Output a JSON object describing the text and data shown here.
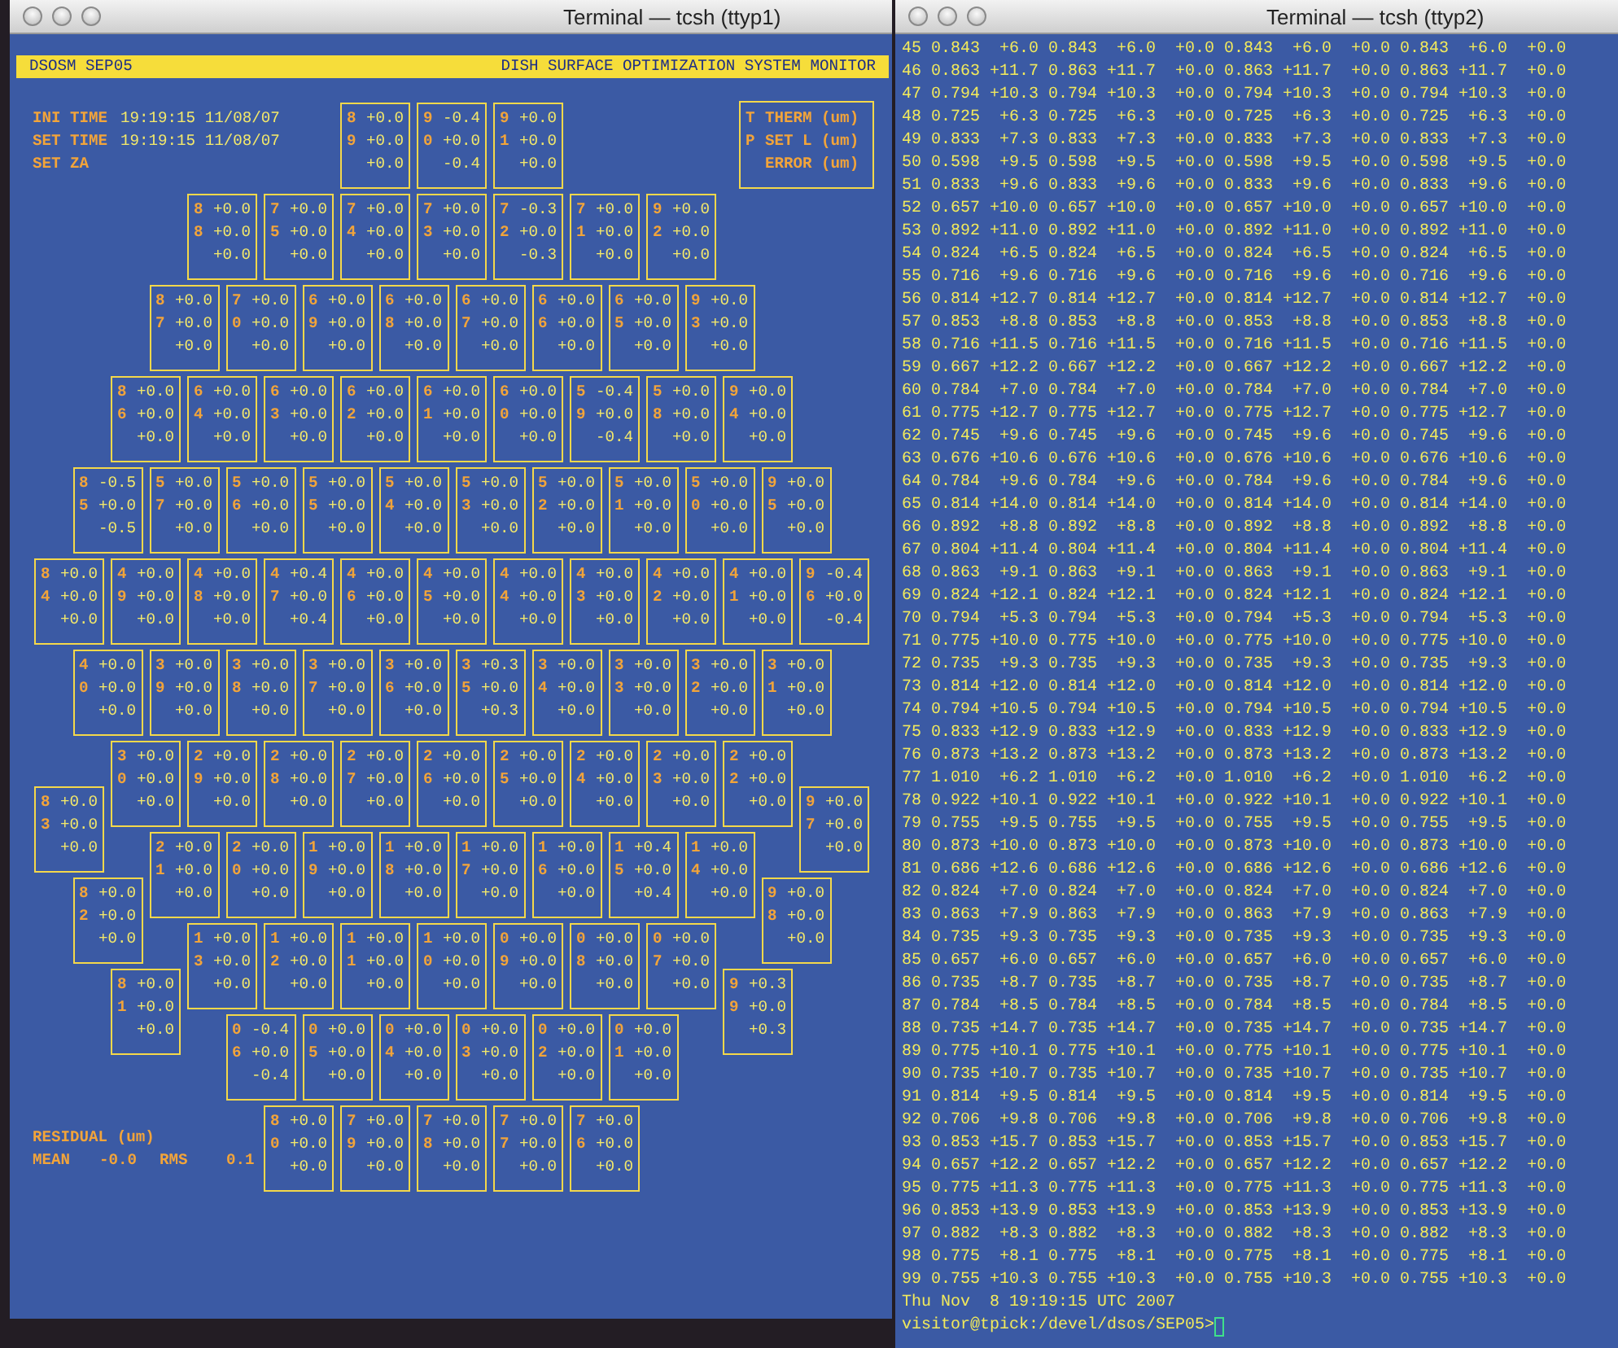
{
  "left_window": {
    "title": "Terminal — tcsh (ttyp1)",
    "header": {
      "left": "DSOSM SEP05",
      "right": "DISH SURFACE OPTIMIZATION SYSTEM MONITOR"
    },
    "times": [
      {
        "label": "INI TIME",
        "value": "19:19:15 11/08/07"
      },
      {
        "label": "SET TIME",
        "value": "19:19:15 11/08/07"
      },
      {
        "label": "SET ZA"
      }
    ],
    "legend": [
      {
        "key": "T",
        "label": "THERM (um)"
      },
      {
        "key": "P",
        "label": "SET L (um)"
      },
      {
        "label": "ERROR (um)"
      }
    ],
    "panel_rows": [
      [
        {
          "t": "8",
          "therm": "+0.0",
          "p": "9",
          "set_l": "+0.0",
          "error": "+0.0"
        },
        {
          "t": "9",
          "therm": "-0.4",
          "p": "0",
          "set_l": "+0.0",
          "error": "-0.4"
        },
        {
          "t": "9",
          "therm": "+0.0",
          "p": "1",
          "set_l": "+0.0",
          "error": "+0.0"
        }
      ],
      [
        {
          "t": "8",
          "therm": "+0.0",
          "p": "8",
          "set_l": "+0.0",
          "error": "+0.0"
        },
        {
          "t": "7",
          "therm": "+0.0",
          "p": "5",
          "set_l": "+0.0",
          "error": "+0.0"
        },
        {
          "t": "7",
          "therm": "+0.0",
          "p": "4",
          "set_l": "+0.0",
          "error": "+0.0"
        },
        {
          "t": "7",
          "therm": "+0.0",
          "p": "3",
          "set_l": "+0.0",
          "error": "+0.0"
        },
        {
          "t": "7",
          "therm": "-0.3",
          "p": "2",
          "set_l": "+0.0",
          "error": "-0.3"
        },
        {
          "t": "7",
          "therm": "+0.0",
          "p": "1",
          "set_l": "+0.0",
          "error": "+0.0"
        },
        {
          "t": "9",
          "therm": "+0.0",
          "p": "2",
          "set_l": "+0.0",
          "error": "+0.0"
        }
      ],
      [
        {
          "t": "8",
          "therm": "+0.0",
          "p": "7",
          "set_l": "+0.0",
          "error": "+0.0"
        },
        {
          "t": "7",
          "therm": "+0.0",
          "p": "0",
          "set_l": "+0.0",
          "error": "+0.0"
        },
        {
          "t": "6",
          "therm": "+0.0",
          "p": "9",
          "set_l": "+0.0",
          "error": "+0.0"
        },
        {
          "t": "6",
          "therm": "+0.0",
          "p": "8",
          "set_l": "+0.0",
          "error": "+0.0"
        },
        {
          "t": "6",
          "therm": "+0.0",
          "p": "7",
          "set_l": "+0.0",
          "error": "+0.0"
        },
        {
          "t": "6",
          "therm": "+0.0",
          "p": "6",
          "set_l": "+0.0",
          "error": "+0.0"
        },
        {
          "t": "6",
          "therm": "+0.0",
          "p": "5",
          "set_l": "+0.0",
          "error": "+0.0"
        },
        {
          "t": "9",
          "therm": "+0.0",
          "p": "3",
          "set_l": "+0.0",
          "error": "+0.0"
        }
      ],
      [
        {
          "t": "8",
          "therm": "+0.0",
          "p": "6",
          "set_l": "+0.0",
          "error": "+0.0"
        },
        {
          "t": "6",
          "therm": "+0.0",
          "p": "4",
          "set_l": "+0.0",
          "error": "+0.0"
        },
        {
          "t": "6",
          "therm": "+0.0",
          "p": "3",
          "set_l": "+0.0",
          "error": "+0.0"
        },
        {
          "t": "6",
          "therm": "+0.0",
          "p": "2",
          "set_l": "+0.0",
          "error": "+0.0"
        },
        {
          "t": "6",
          "therm": "+0.0",
          "p": "1",
          "set_l": "+0.0",
          "error": "+0.0"
        },
        {
          "t": "6",
          "therm": "+0.0",
          "p": "0",
          "set_l": "+0.0",
          "error": "+0.0"
        },
        {
          "t": "5",
          "therm": "-0.4",
          "p": "9",
          "set_l": "+0.0",
          "error": "-0.4"
        },
        {
          "t": "5",
          "therm": "+0.0",
          "p": "8",
          "set_l": "+0.0",
          "error": "+0.0"
        },
        {
          "t": "9",
          "therm": "+0.0",
          "p": "4",
          "set_l": "+0.0",
          "error": "+0.0"
        }
      ],
      [
        {
          "t": "8",
          "therm": "-0.5",
          "p": "5",
          "set_l": "+0.0",
          "error": "-0.5"
        },
        {
          "t": "5",
          "therm": "+0.0",
          "p": "7",
          "set_l": "+0.0",
          "error": "+0.0"
        },
        {
          "t": "5",
          "therm": "+0.0",
          "p": "6",
          "set_l": "+0.0",
          "error": "+0.0"
        },
        {
          "t": "5",
          "therm": "+0.0",
          "p": "5",
          "set_l": "+0.0",
          "error": "+0.0"
        },
        {
          "t": "5",
          "therm": "+0.0",
          "p": "4",
          "set_l": "+0.0",
          "error": "+0.0"
        },
        {
          "t": "5",
          "therm": "+0.0",
          "p": "3",
          "set_l": "+0.0",
          "error": "+0.0"
        },
        {
          "t": "5",
          "therm": "+0.0",
          "p": "2",
          "set_l": "+0.0",
          "error": "+0.0"
        },
        {
          "t": "5",
          "therm": "+0.0",
          "p": "1",
          "set_l": "+0.0",
          "error": "+0.0"
        },
        {
          "t": "5",
          "therm": "+0.0",
          "p": "0",
          "set_l": "+0.0",
          "error": "+0.0"
        },
        {
          "t": "9",
          "therm": "+0.0",
          "p": "5",
          "set_l": "+0.0",
          "error": "+0.0"
        }
      ],
      [
        {
          "t": "8",
          "therm": "+0.0",
          "p": "4",
          "set_l": "+0.0",
          "error": "+0.0"
        },
        {
          "t": "4",
          "therm": "+0.0",
          "p": "9",
          "set_l": "+0.0",
          "error": "+0.0"
        },
        {
          "t": "4",
          "therm": "+0.0",
          "p": "8",
          "set_l": "+0.0",
          "error": "+0.0"
        },
        {
          "t": "4",
          "therm": "+0.4",
          "p": "7",
          "set_l": "+0.0",
          "error": "+0.4"
        },
        {
          "t": "4",
          "therm": "+0.0",
          "p": "6",
          "set_l": "+0.0",
          "error": "+0.0"
        },
        {
          "t": "4",
          "therm": "+0.0",
          "p": "5",
          "set_l": "+0.0",
          "error": "+0.0"
        },
        {
          "t": "4",
          "therm": "+0.0",
          "p": "4",
          "set_l": "+0.0",
          "error": "+0.0"
        },
        {
          "t": "4",
          "therm": "+0.0",
          "p": "3",
          "set_l": "+0.0",
          "error": "+0.0"
        },
        {
          "t": "4",
          "therm": "+0.0",
          "p": "2",
          "set_l": "+0.0",
          "error": "+0.0"
        },
        {
          "t": "4",
          "therm": "+0.0",
          "p": "1",
          "set_l": "+0.0",
          "error": "+0.0"
        },
        {
          "t": "9",
          "therm": "-0.4",
          "p": "6",
          "set_l": "+0.0",
          "error": "-0.4"
        }
      ],
      [
        {
          "t": "4",
          "therm": "+0.0",
          "p": "0",
          "set_l": "+0.0",
          "error": "+0.0"
        },
        {
          "t": "3",
          "therm": "+0.0",
          "p": "9",
          "set_l": "+0.0",
          "error": "+0.0"
        },
        {
          "t": "3",
          "therm": "+0.0",
          "p": "8",
          "set_l": "+0.0",
          "error": "+0.0"
        },
        {
          "t": "3",
          "therm": "+0.0",
          "p": "7",
          "set_l": "+0.0",
          "error": "+0.0"
        },
        {
          "t": "3",
          "therm": "+0.0",
          "p": "6",
          "set_l": "+0.0",
          "error": "+0.0"
        },
        {
          "t": "3",
          "therm": "+0.3",
          "p": "5",
          "set_l": "+0.0",
          "error": "+0.3"
        },
        {
          "t": "3",
          "therm": "+0.0",
          "p": "4",
          "set_l": "+0.0",
          "error": "+0.0"
        },
        {
          "t": "3",
          "therm": "+0.0",
          "p": "3",
          "set_l": "+0.0",
          "error": "+0.0"
        },
        {
          "t": "3",
          "therm": "+0.0",
          "p": "2",
          "set_l": "+0.0",
          "error": "+0.0"
        },
        {
          "t": "3",
          "therm": "+0.0",
          "p": "1",
          "set_l": "+0.0",
          "error": "+0.0"
        }
      ],
      [
        {
          "t": "3",
          "therm": "+0.0",
          "p": "0",
          "set_l": "+0.0",
          "error": "+0.0"
        },
        {
          "t": "2",
          "therm": "+0.0",
          "p": "9",
          "set_l": "+0.0",
          "error": "+0.0"
        },
        {
          "t": "2",
          "therm": "+0.0",
          "p": "8",
          "set_l": "+0.0",
          "error": "+0.0"
        },
        {
          "t": "2",
          "therm": "+0.0",
          "p": "7",
          "set_l": "+0.0",
          "error": "+0.0"
        },
        {
          "t": "2",
          "therm": "+0.0",
          "p": "6",
          "set_l": "+0.0",
          "error": "+0.0"
        },
        {
          "t": "2",
          "therm": "+0.0",
          "p": "5",
          "set_l": "+0.0",
          "error": "+0.0"
        },
        {
          "t": "2",
          "therm": "+0.0",
          "p": "4",
          "set_l": "+0.0",
          "error": "+0.0"
        },
        {
          "t": "2",
          "therm": "+0.0",
          "p": "3",
          "set_l": "+0.0",
          "error": "+0.0"
        },
        {
          "t": "2",
          "therm": "+0.0",
          "p": "2",
          "set_l": "+0.0",
          "error": "+0.0"
        }
      ],
      [
        {
          "t": "2",
          "therm": "+0.0",
          "p": "1",
          "set_l": "+0.0",
          "error": "+0.0"
        },
        {
          "t": "2",
          "therm": "+0.0",
          "p": "0",
          "set_l": "+0.0",
          "error": "+0.0"
        },
        {
          "t": "1",
          "therm": "+0.0",
          "p": "9",
          "set_l": "+0.0",
          "error": "+0.0"
        },
        {
          "t": "1",
          "therm": "+0.0",
          "p": "8",
          "set_l": "+0.0",
          "error": "+0.0"
        },
        {
          "t": "1",
          "therm": "+0.0",
          "p": "7",
          "set_l": "+0.0",
          "error": "+0.0"
        },
        {
          "t": "1",
          "therm": "+0.0",
          "p": "6",
          "set_l": "+0.0",
          "error": "+0.0"
        },
        {
          "t": "1",
          "therm": "+0.4",
          "p": "5",
          "set_l": "+0.0",
          "error": "+0.4"
        },
        {
          "t": "1",
          "therm": "+0.0",
          "p": "4",
          "set_l": "+0.0",
          "error": "+0.0"
        }
      ],
      [
        {
          "t": "1",
          "therm": "+0.0",
          "p": "3",
          "set_l": "+0.0",
          "error": "+0.0"
        },
        {
          "t": "1",
          "therm": "+0.0",
          "p": "2",
          "set_l": "+0.0",
          "error": "+0.0"
        },
        {
          "t": "1",
          "therm": "+0.0",
          "p": "1",
          "set_l": "+0.0",
          "error": "+0.0"
        },
        {
          "t": "1",
          "therm": "+0.0",
          "p": "0",
          "set_l": "+0.0",
          "error": "+0.0"
        },
        {
          "t": "0",
          "therm": "+0.0",
          "p": "9",
          "set_l": "+0.0",
          "error": "+0.0"
        },
        {
          "t": "0",
          "therm": "+0.0",
          "p": "8",
          "set_l": "+0.0",
          "error": "+0.0"
        },
        {
          "t": "0",
          "therm": "+0.0",
          "p": "7",
          "set_l": "+0.0",
          "error": "+0.0"
        }
      ],
      [
        {
          "t": "0",
          "therm": "-0.4",
          "p": "6",
          "set_l": "+0.0",
          "error": "-0.4"
        },
        {
          "t": "0",
          "therm": "+0.0",
          "p": "5",
          "set_l": "+0.0",
          "error": "+0.0"
        },
        {
          "t": "0",
          "therm": "+0.0",
          "p": "4",
          "set_l": "+0.0",
          "error": "+0.0"
        },
        {
          "t": "0",
          "therm": "+0.0",
          "p": "3",
          "set_l": "+0.0",
          "error": "+0.0"
        },
        {
          "t": "0",
          "therm": "+0.0",
          "p": "2",
          "set_l": "+0.0",
          "error": "+0.0"
        },
        {
          "t": "0",
          "therm": "+0.0",
          "p": "1",
          "set_l": "+0.0",
          "error": "+0.0"
        }
      ],
      [
        {
          "t": "8",
          "therm": "+0.0",
          "p": "0",
          "set_l": "+0.0",
          "error": "+0.0"
        },
        {
          "t": "7",
          "therm": "+0.0",
          "p": "9",
          "set_l": "+0.0",
          "error": "+0.0"
        },
        {
          "t": "7",
          "therm": "+0.0",
          "p": "8",
          "set_l": "+0.0",
          "error": "+0.0"
        },
        {
          "t": "7",
          "therm": "+0.0",
          "p": "7",
          "set_l": "+0.0",
          "error": "+0.0"
        },
        {
          "t": "7",
          "therm": "+0.0",
          "p": "6",
          "set_l": "+0.0",
          "error": "+0.0"
        }
      ]
    ],
    "side_panels": [
      {
        "t": "8",
        "therm": "+0.0",
        "p": "3",
        "set_l": "+0.0",
        "error": "+0.0"
      },
      {
        "t": "9",
        "therm": "+0.0",
        "p": "7",
        "set_l": "+0.0",
        "error": "+0.0"
      },
      {
        "t": "8",
        "therm": "+0.0",
        "p": "2",
        "set_l": "+0.0",
        "error": "+0.0"
      },
      {
        "t": "9",
        "therm": "+0.0",
        "p": "8",
        "set_l": "+0.0",
        "error": "+0.0"
      },
      {
        "t": "8",
        "therm": "+0.0",
        "p": "1",
        "set_l": "+0.0",
        "error": "+0.0"
      },
      {
        "t": "9",
        "therm": "+0.3",
        "p": "9",
        "set_l": "+0.0",
        "error": "+0.3"
      }
    ],
    "residual": {
      "title": "RESIDUAL (um)",
      "mean_label": "MEAN",
      "mean": "-0.0",
      "rms_label": "RMS",
      "rms": "0.1"
    }
  },
  "right_window": {
    "title": "Terminal — tcsh (ttyp2)",
    "lines": [
      "45 0.843  +6.0 0.843  +6.0  +0.0 0.843  +6.0  +0.0 0.843  +6.0  +0.0",
      "46 0.863 +11.7 0.863 +11.7  +0.0 0.863 +11.7  +0.0 0.863 +11.7  +0.0",
      "47 0.794 +10.3 0.794 +10.3  +0.0 0.794 +10.3  +0.0 0.794 +10.3  +0.0",
      "48 0.725  +6.3 0.725  +6.3  +0.0 0.725  +6.3  +0.0 0.725  +6.3  +0.0",
      "49 0.833  +7.3 0.833  +7.3  +0.0 0.833  +7.3  +0.0 0.833  +7.3  +0.0",
      "50 0.598  +9.5 0.598  +9.5  +0.0 0.598  +9.5  +0.0 0.598  +9.5  +0.0",
      "51 0.833  +9.6 0.833  +9.6  +0.0 0.833  +9.6  +0.0 0.833  +9.6  +0.0",
      "52 0.657 +10.0 0.657 +10.0  +0.0 0.657 +10.0  +0.0 0.657 +10.0  +0.0",
      "53 0.892 +11.0 0.892 +11.0  +0.0 0.892 +11.0  +0.0 0.892 +11.0  +0.0",
      "54 0.824  +6.5 0.824  +6.5  +0.0 0.824  +6.5  +0.0 0.824  +6.5  +0.0",
      "55 0.716  +9.6 0.716  +9.6  +0.0 0.716  +9.6  +0.0 0.716  +9.6  +0.0",
      "56 0.814 +12.7 0.814 +12.7  +0.0 0.814 +12.7  +0.0 0.814 +12.7  +0.0",
      "57 0.853  +8.8 0.853  +8.8  +0.0 0.853  +8.8  +0.0 0.853  +8.8  +0.0",
      "58 0.716 +11.5 0.716 +11.5  +0.0 0.716 +11.5  +0.0 0.716 +11.5  +0.0",
      "59 0.667 +12.2 0.667 +12.2  +0.0 0.667 +12.2  +0.0 0.667 +12.2  +0.0",
      "60 0.784  +7.0 0.784  +7.0  +0.0 0.784  +7.0  +0.0 0.784  +7.0  +0.0",
      "61 0.775 +12.7 0.775 +12.7  +0.0 0.775 +12.7  +0.0 0.775 +12.7  +0.0",
      "62 0.745  +9.6 0.745  +9.6  +0.0 0.745  +9.6  +0.0 0.745  +9.6  +0.0",
      "63 0.676 +10.6 0.676 +10.6  +0.0 0.676 +10.6  +0.0 0.676 +10.6  +0.0",
      "64 0.784  +9.6 0.784  +9.6  +0.0 0.784  +9.6  +0.0 0.784  +9.6  +0.0",
      "65 0.814 +14.0 0.814 +14.0  +0.0 0.814 +14.0  +0.0 0.814 +14.0  +0.0",
      "66 0.892  +8.8 0.892  +8.8  +0.0 0.892  +8.8  +0.0 0.892  +8.8  +0.0",
      "67 0.804 +11.4 0.804 +11.4  +0.0 0.804 +11.4  +0.0 0.804 +11.4  +0.0",
      "68 0.863  +9.1 0.863  +9.1  +0.0 0.863  +9.1  +0.0 0.863  +9.1  +0.0",
      "69 0.824 +12.1 0.824 +12.1  +0.0 0.824 +12.1  +0.0 0.824 +12.1  +0.0",
      "70 0.794  +5.3 0.794  +5.3  +0.0 0.794  +5.3  +0.0 0.794  +5.3  +0.0",
      "71 0.775 +10.0 0.775 +10.0  +0.0 0.775 +10.0  +0.0 0.775 +10.0  +0.0",
      "72 0.735  +9.3 0.735  +9.3  +0.0 0.735  +9.3  +0.0 0.735  +9.3  +0.0",
      "73 0.814 +12.0 0.814 +12.0  +0.0 0.814 +12.0  +0.0 0.814 +12.0  +0.0",
      "74 0.794 +10.5 0.794 +10.5  +0.0 0.794 +10.5  +0.0 0.794 +10.5  +0.0",
      "75 0.833 +12.9 0.833 +12.9  +0.0 0.833 +12.9  +0.0 0.833 +12.9  +0.0",
      "76 0.873 +13.2 0.873 +13.2  +0.0 0.873 +13.2  +0.0 0.873 +13.2  +0.0",
      "77 1.010  +6.2 1.010  +6.2  +0.0 1.010  +6.2  +0.0 1.010  +6.2  +0.0",
      "78 0.922 +10.1 0.922 +10.1  +0.0 0.922 +10.1  +0.0 0.922 +10.1  +0.0",
      "79 0.755  +9.5 0.755  +9.5  +0.0 0.755  +9.5  +0.0 0.755  +9.5  +0.0",
      "80 0.873 +10.0 0.873 +10.0  +0.0 0.873 +10.0  +0.0 0.873 +10.0  +0.0",
      "81 0.686 +12.6 0.686 +12.6  +0.0 0.686 +12.6  +0.0 0.686 +12.6  +0.0",
      "82 0.824  +7.0 0.824  +7.0  +0.0 0.824  +7.0  +0.0 0.824  +7.0  +0.0",
      "83 0.863  +7.9 0.863  +7.9  +0.0 0.863  +7.9  +0.0 0.863  +7.9  +0.0",
      "84 0.735  +9.3 0.735  +9.3  +0.0 0.735  +9.3  +0.0 0.735  +9.3  +0.0",
      "85 0.657  +6.0 0.657  +6.0  +0.0 0.657  +6.0  +0.0 0.657  +6.0  +0.0",
      "86 0.735  +8.7 0.735  +8.7  +0.0 0.735  +8.7  +0.0 0.735  +8.7  +0.0",
      "87 0.784  +8.5 0.784  +8.5  +0.0 0.784  +8.5  +0.0 0.784  +8.5  +0.0",
      "88 0.735 +14.7 0.735 +14.7  +0.0 0.735 +14.7  +0.0 0.735 +14.7  +0.0",
      "89 0.775 +10.1 0.775 +10.1  +0.0 0.775 +10.1  +0.0 0.775 +10.1  +0.0",
      "90 0.735 +10.7 0.735 +10.7  +0.0 0.735 +10.7  +0.0 0.735 +10.7  +0.0",
      "91 0.814  +9.5 0.814  +9.5  +0.0 0.814  +9.5  +0.0 0.814  +9.5  +0.0",
      "92 0.706  +9.8 0.706  +9.8  +0.0 0.706  +9.8  +0.0 0.706  +9.8  +0.0",
      "93 0.853 +15.7 0.853 +15.7  +0.0 0.853 +15.7  +0.0 0.853 +15.7  +0.0",
      "94 0.657 +12.2 0.657 +12.2  +0.0 0.657 +12.2  +0.0 0.657 +12.2  +0.0",
      "95 0.775 +11.3 0.775 +11.3  +0.0 0.775 +11.3  +0.0 0.775 +11.3  +0.0",
      "96 0.853 +13.9 0.853 +13.9  +0.0 0.853 +13.9  +0.0 0.853 +13.9  +0.0",
      "97 0.882  +8.3 0.882  +8.3  +0.0 0.882  +8.3  +0.0 0.882  +8.3  +0.0",
      "98 0.775  +8.1 0.775  +8.1  +0.0 0.775  +8.1  +0.0 0.775  +8.1  +0.0",
      "99 0.755 +10.3 0.755 +10.3  +0.0 0.755 +10.3  +0.0 0.755 +10.3  +0.0"
    ],
    "date": "Thu Nov  8 19:19:15 UTC 2007",
    "prompt": "visitor@tpick:/devel/dsos/SEP05>"
  }
}
